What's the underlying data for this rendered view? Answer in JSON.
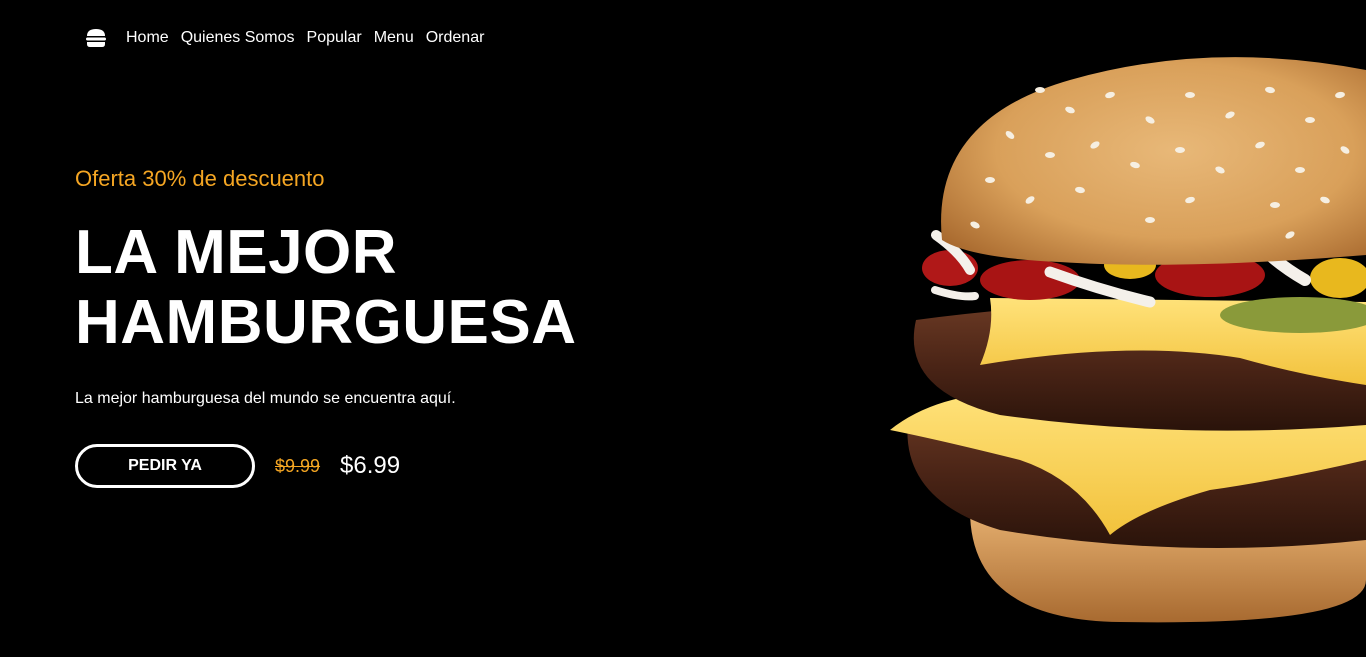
{
  "nav": {
    "logo_icon": "burger-icon",
    "links": [
      "Home",
      "Quienes Somos",
      "Popular",
      "Menu",
      "Ordenar"
    ]
  },
  "hero": {
    "offer": "Oferta 30% de descuento",
    "title_line1": "LA MEJOR",
    "title_line2": "HAMBURGUESA",
    "description": "La mejor hamburguesa del mundo se encuentra aquí.",
    "button_label": "PEDIR YA",
    "old_price": "$9.99",
    "new_price": "$6.99"
  },
  "colors": {
    "background": "#000000",
    "accent": "#f5a623",
    "text": "#ffffff"
  }
}
